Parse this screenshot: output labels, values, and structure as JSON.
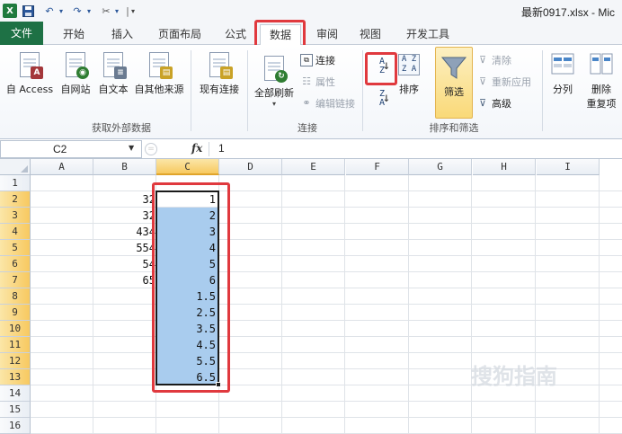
{
  "titlebar": {
    "filename": "最新0917.xlsx - Mic",
    "quick_access": [
      "excel-logo-icon",
      "save-icon",
      "undo-icon",
      "redo-icon",
      "customize-tools-icon"
    ]
  },
  "tabs": {
    "file": "文件",
    "home": "开始",
    "insert": "插入",
    "layout": "页面布局",
    "formula": "公式",
    "data": "数据",
    "review": "审阅",
    "view": "视图",
    "developer": "开发工具",
    "active": "数据"
  },
  "ribbon": {
    "external": {
      "access": "自 Access",
      "web": "自网站",
      "text": "自文本",
      "other": "自其他来源",
      "existing": "现有连接",
      "group_label": "获取外部数据"
    },
    "connections": {
      "refresh_all": "全部刷新",
      "connections": "连接",
      "properties": "属性",
      "edit_links": "编辑链接",
      "group_label": "连接"
    },
    "sort_filter": {
      "sort": "排序",
      "filter": "筛选",
      "clear": "清除",
      "reapply": "重新应用",
      "advanced": "高级",
      "group_label": "排序和筛选"
    },
    "tools": {
      "split": "分列",
      "remove_dup_1": "删除",
      "remove_dup_2": "重复项"
    }
  },
  "formula_bar": {
    "name_box": "C2",
    "fx": "fx",
    "value": "1"
  },
  "grid": {
    "columns": [
      "A",
      "B",
      "C",
      "D",
      "E",
      "F",
      "G",
      "H",
      "I"
    ],
    "rows": [
      "1",
      "2",
      "3",
      "4",
      "5",
      "6",
      "7",
      "8",
      "9",
      "10",
      "11",
      "12",
      "13",
      "14",
      "15",
      "16"
    ],
    "selected_column": "C",
    "column_b_values": [
      "32",
      "32",
      "434",
      "554",
      "54",
      "65"
    ],
    "column_c_values": [
      "1",
      "2",
      "3",
      "4",
      "5",
      "6",
      "1.5",
      "2.5",
      "3.5",
      "4.5",
      "5.5",
      "6.5"
    ]
  },
  "watermark": "搜狗指南",
  "colors": {
    "file_tab": "#1e7145",
    "highlight_red": "#e0393e",
    "selection_fill": "#a9ccee",
    "header_selected": "#f7c960"
  }
}
